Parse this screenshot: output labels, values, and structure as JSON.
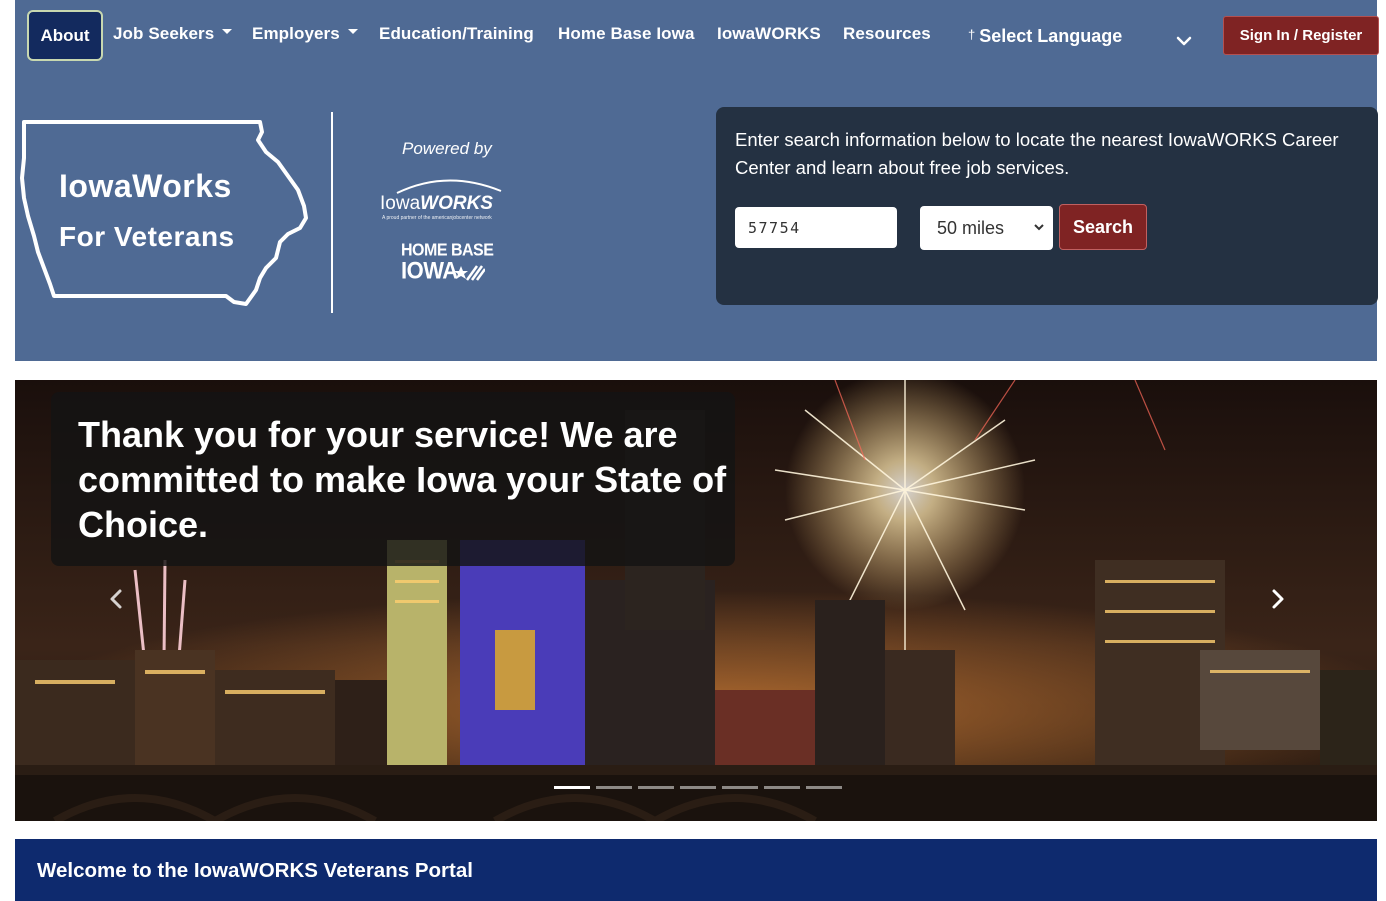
{
  "nav": {
    "about": "About",
    "job_seekers": "Job Seekers",
    "employers": "Employers",
    "education": "Education/Training",
    "home_base_iowa": "Home Base Iowa",
    "iowaworks": "IowaWORKS",
    "resources": "Resources",
    "language": "Select Language",
    "language_glyph": "†",
    "sign_in": "Sign In / Register"
  },
  "logo": {
    "line1": "IowaWorks",
    "line2": "For Veterans",
    "powered_by": "Powered by",
    "iowaworks_prefix": "Iowa",
    "iowaworks_suffix": "WORKS",
    "iowaworks_tagline": "A proud partner of the americanjobcenter network",
    "home_base_line1": "HOME BASE",
    "home_base_line2": "IOWA"
  },
  "search": {
    "description": "Enter search information below to locate the nearest IowaWORKS Career Center and learn about free job services.",
    "zip_value": "57754",
    "radius_selected": "50 miles",
    "button": "Search"
  },
  "carousel": {
    "caption": "Thank you for your service! We are committed to make Iowa your State of Choice.",
    "slide_count": 7,
    "active_slide": 1
  },
  "welcome": {
    "title": "Welcome to the IowaWORKS Veterans Portal"
  },
  "colors": {
    "header_bg": "#4f6a94",
    "about_bg": "#132a5e",
    "accent_red": "#7f2323",
    "search_panel_bg": "#243142",
    "welcome_bg": "#0e2a6e"
  },
  "icons": [
    "caret-down-icon",
    "chevron-down-icon",
    "chevron-left-icon",
    "chevron-right-icon",
    "iowa-state-outline-icon",
    "flag-icon"
  ]
}
